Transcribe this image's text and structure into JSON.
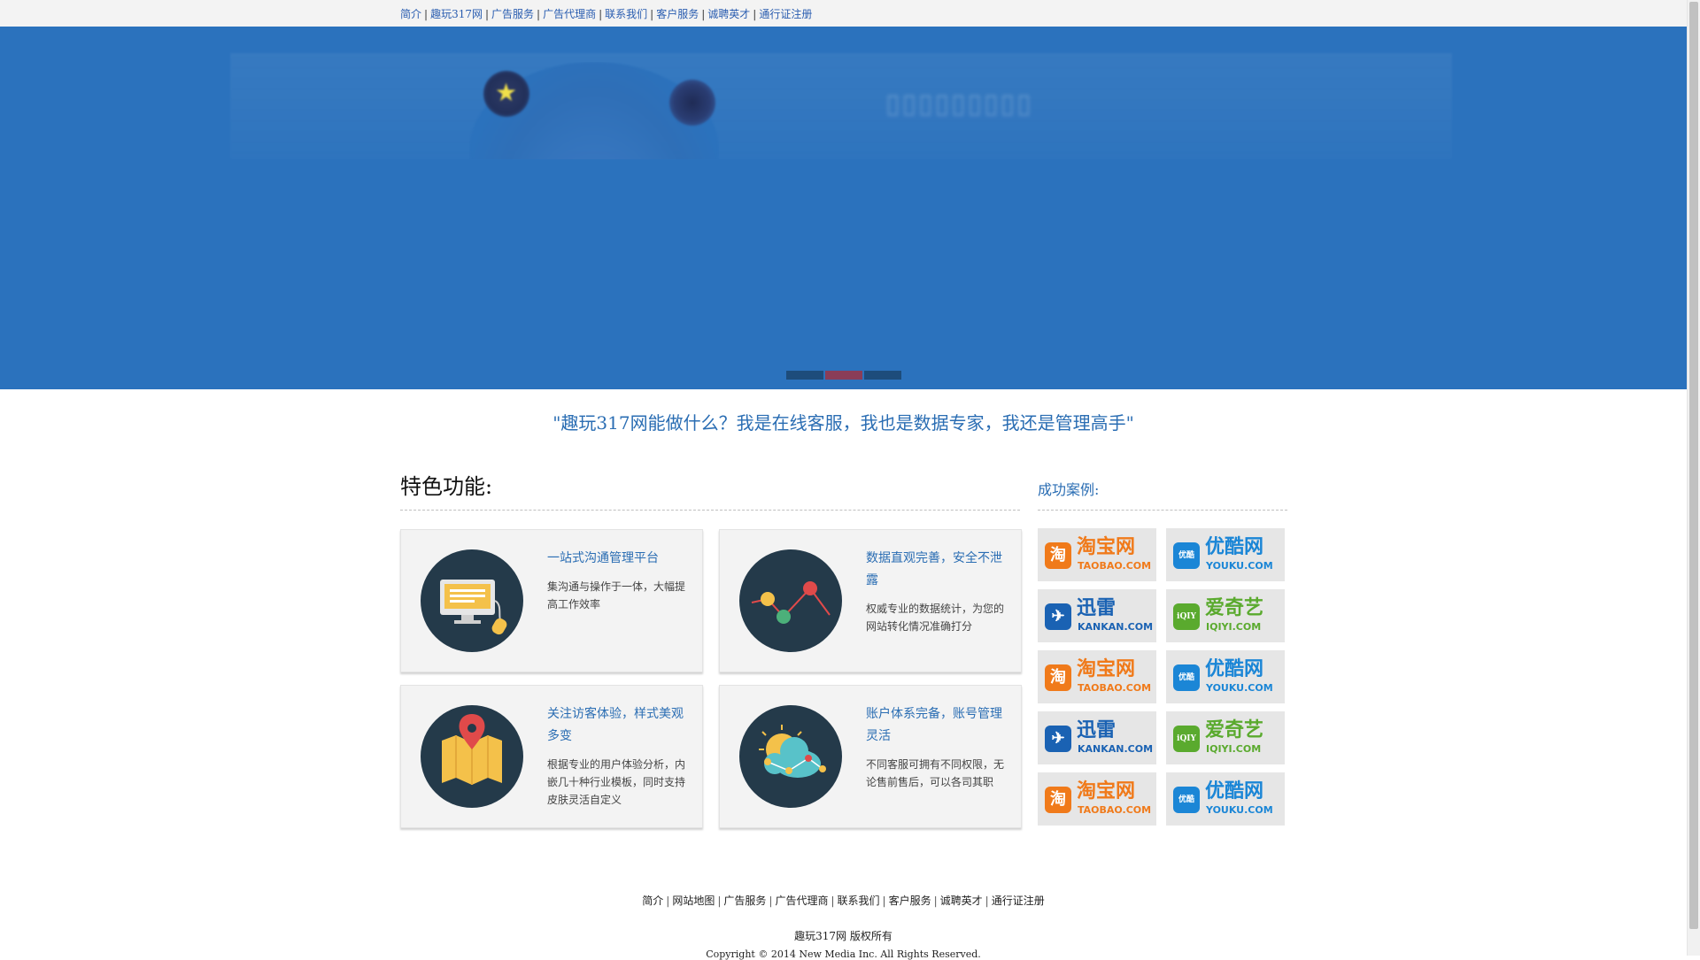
{
  "top_nav": {
    "items": [
      "简介",
      "趣玩317网",
      "广告服务",
      "广告代理商",
      "联系我们",
      "客户服务",
      "诚聘英才",
      "通行证注册"
    ]
  },
  "banner": {
    "slides": 3,
    "active_slide": 2
  },
  "tagline": "\"趣玩317网能做什么？我是在线客服，我也是数据专家，我还是管理高手\"",
  "features": {
    "title": "特色功能:",
    "cards": [
      {
        "title": "一站式沟通管理平台",
        "desc": "集沟通与操作于一体，大幅提高工作效率",
        "icon": "monitor-icon"
      },
      {
        "title": "数据直观完善，安全不泄露",
        "desc": "权威专业的数据统计，为您的网站转化情况准确打分",
        "icon": "line-chart-icon"
      },
      {
        "title": "关注访客体验，样式美观多变",
        "desc": "根据专业的用户体验分析，内嵌几十种行业模板，同时支持皮肤灵活自定义",
        "icon": "map-pin-icon"
      },
      {
        "title": "账户体系完备，账号管理灵活",
        "desc": "不同客服可拥有不同权限，无论售前售后，可以各司其职",
        "icon": "cloud-network-icon"
      }
    ]
  },
  "cases": {
    "title": "成功案例:",
    "logos": [
      {
        "cn": "淘宝网",
        "en": "TAOBAO.COM",
        "mark": "淘",
        "color": "#f07a1a",
        "en_color": "#f07a1a"
      },
      {
        "cn": "优酷网",
        "en": "YOUKU.COM",
        "mark": "优酷",
        "color": "#1b86d6",
        "en_color": "#1b86d6"
      },
      {
        "cn": "迅雷",
        "en": "KANKAN.COM",
        "mark": "✈",
        "color": "#1a62b3",
        "en_color": "#1a62b3"
      },
      {
        "cn": "爱奇艺",
        "en": "IQIYI.COM",
        "mark": "iQIY",
        "color": "#5aaa2e",
        "en_color": "#5aaa2e"
      },
      {
        "cn": "淘宝网",
        "en": "TAOBAO.COM",
        "mark": "淘",
        "color": "#f07a1a",
        "en_color": "#f07a1a"
      },
      {
        "cn": "优酷网",
        "en": "YOUKU.COM",
        "mark": "优酷",
        "color": "#1b86d6",
        "en_color": "#1b86d6"
      },
      {
        "cn": "迅雷",
        "en": "KANKAN.COM",
        "mark": "✈",
        "color": "#1a62b3",
        "en_color": "#1a62b3"
      },
      {
        "cn": "爱奇艺",
        "en": "IQIYI.COM",
        "mark": "iQIY",
        "color": "#5aaa2e",
        "en_color": "#5aaa2e"
      },
      {
        "cn": "淘宝网",
        "en": "TAOBAO.COM",
        "mark": "淘",
        "color": "#f07a1a",
        "en_color": "#f07a1a"
      },
      {
        "cn": "优酷网",
        "en": "YOUKU.COM",
        "mark": "优酷",
        "color": "#1b86d6",
        "en_color": "#1b86d6"
      }
    ]
  },
  "footer": {
    "links": [
      "简介",
      "网站地图",
      "广告服务",
      "广告代理商",
      "联系我们",
      "客户服务",
      "诚聘英才",
      "通行证注册"
    ],
    "copyright_cn": "趣玩317网 版权所有",
    "copyright_en": "Copyright © 2014 New Media Inc. All Rights Reserved."
  },
  "colors": {
    "accent": "#2a6db3",
    "banner_bg": "#2b72bd",
    "icon_circle": "#243a4a"
  }
}
